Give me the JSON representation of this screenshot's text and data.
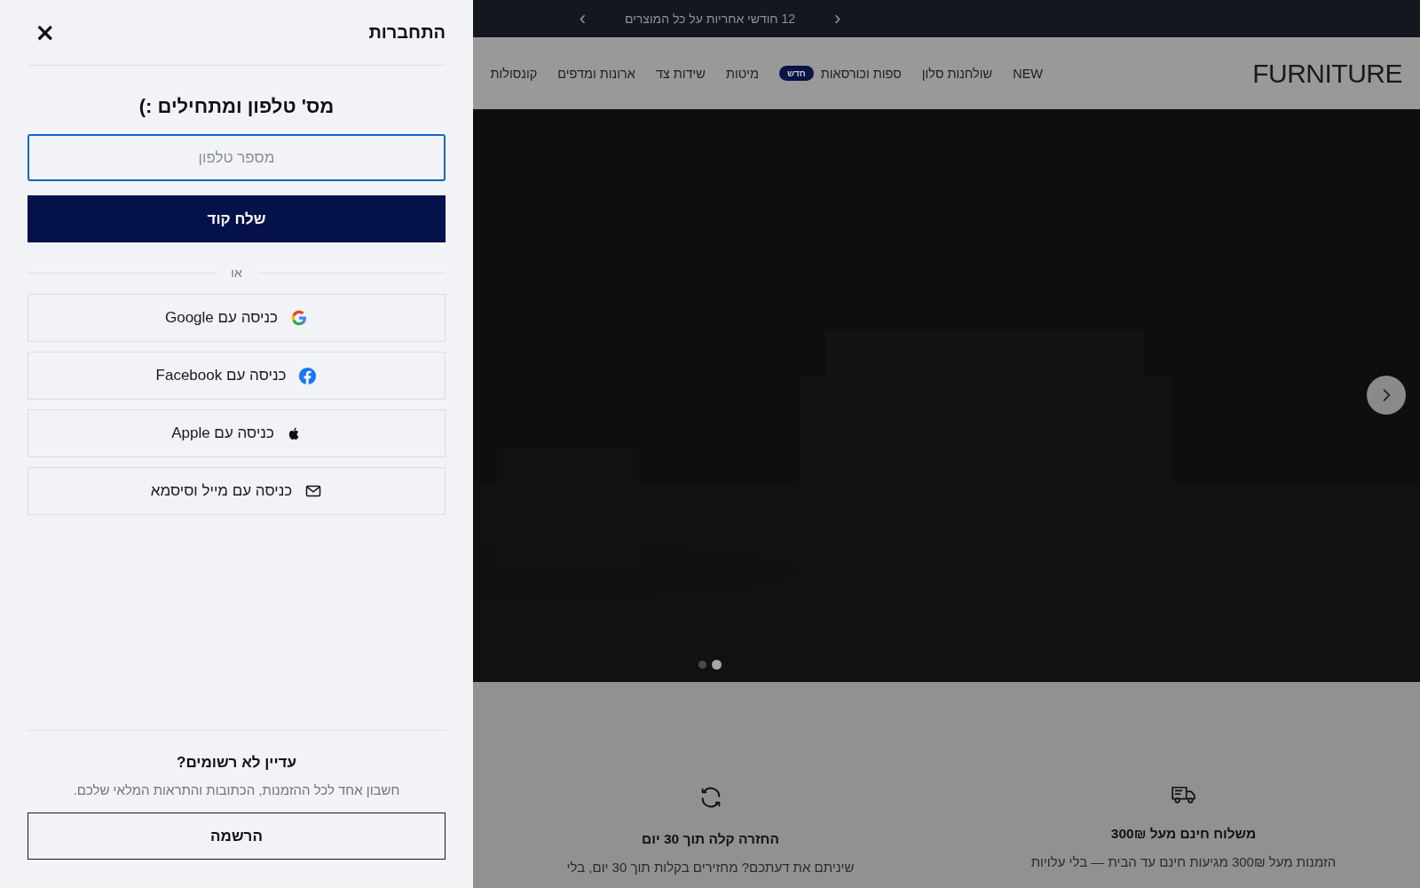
{
  "announcement": {
    "text": "12 חודשי אחריות על כל המוצרים",
    "prev": "‹",
    "next": "›"
  },
  "header": {
    "logo": "FURNITURE",
    "nav": [
      {
        "label": "NEW"
      },
      {
        "label": "שולחנות סלון"
      },
      {
        "label": "ספות וכורסאות",
        "badge": "חדש"
      },
      {
        "label": "מיטות"
      },
      {
        "label": "שידות צד"
      },
      {
        "label": "ארונות ומדפים"
      },
      {
        "label": "קונסולות"
      }
    ]
  },
  "hero": {
    "kind": "picture",
    "dots": [
      {
        "selected": true
      },
      {
        "selected": false
      }
    ]
  },
  "features": [
    {
      "kind": "truck",
      "title": "משלוח חינם מעל 300₪",
      "text": "הזמנות מעל 300₪ מגיעות חינם עד הבית — בלי עלויות"
    },
    {
      "kind": "refresh",
      "title": "החזרה קלה תוך 30 יום",
      "text": "שיניתם את דעתכם? מחזירים בקלות תוך 30 יום, בלי"
    }
  ],
  "drawer": {
    "title": "התחברות",
    "close": "×",
    "heading": "מס' טלפון ומתחילים :)",
    "phone": {
      "placeholder": "מספר טלפון",
      "focused": true
    },
    "send_button": "שלח קוד",
    "or": "או",
    "providers": [
      {
        "kind": "google",
        "label": "כניסה עם Google"
      },
      {
        "kind": "facebook",
        "label": "כניסה עם Facebook"
      },
      {
        "kind": "apple",
        "label": "כניסה עם Apple"
      },
      {
        "kind": "mail",
        "label": "כניסה עם מייל וסיסמא"
      }
    ],
    "signup": {
      "title": "עדיין לא רשומים?",
      "text": "חשבון אחד לכל ההזמנות, הכתובות והתראות המלאי שלכם.",
      "button": "הרשמה"
    }
  }
}
